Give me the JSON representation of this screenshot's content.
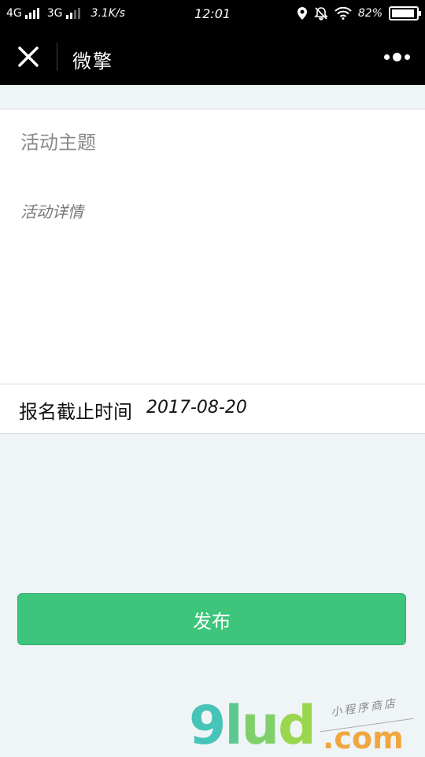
{
  "status_bar": {
    "network_1": "4G",
    "network_2": "3G",
    "speed": "3.1K/s",
    "time": "12:01",
    "battery": "82%"
  },
  "nav": {
    "title": "微擎",
    "close_icon": "close-icon",
    "more_icon": "more-icon"
  },
  "form": {
    "topic_placeholder": "活动主题",
    "detail_placeholder": "活动详情",
    "deadline_label": "报名截止时间",
    "deadline_value": "2017-08-20"
  },
  "actions": {
    "publish_label": "发布"
  },
  "watermark": {
    "logo_g": "9",
    "logo_l": "l",
    "logo_u": "u",
    "logo_d": "d",
    "dotcom": ".com",
    "tagline": "小程序商店"
  },
  "colors": {
    "publish_bg": "#3cc57b",
    "page_bg": "#eff4f6",
    "bar_bg": "#000000"
  }
}
